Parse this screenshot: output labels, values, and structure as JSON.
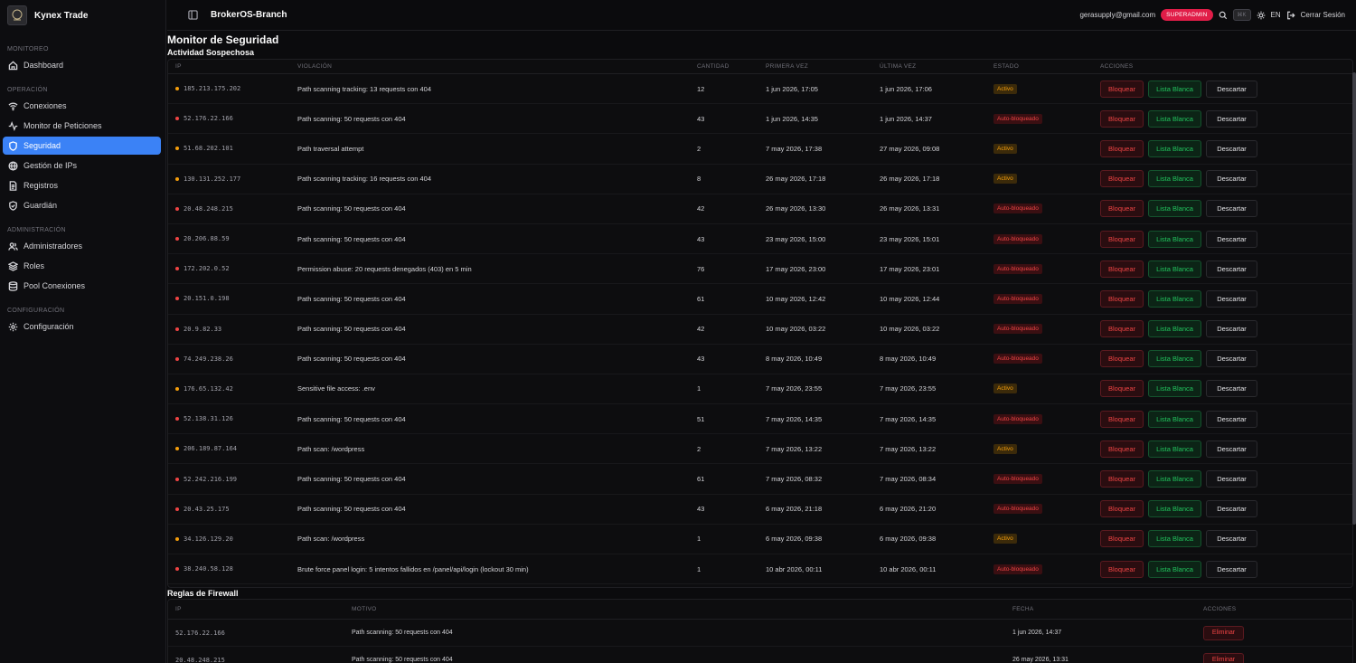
{
  "brand": {
    "name": "Kynex Trade"
  },
  "sidebar": {
    "sections": [
      {
        "label": "MONITOREO",
        "items": [
          {
            "label": "Dashboard",
            "icon": "home-icon"
          }
        ]
      },
      {
        "label": "OPERACIÓN",
        "items": [
          {
            "label": "Conexiones",
            "icon": "wifi-icon"
          },
          {
            "label": "Monitor de Peticiones",
            "icon": "activity-icon"
          },
          {
            "label": "Seguridad",
            "icon": "shield-icon",
            "active": true
          },
          {
            "label": "Gestión de IPs",
            "icon": "globe-icon"
          },
          {
            "label": "Registros",
            "icon": "file-icon"
          },
          {
            "label": "Guardián",
            "icon": "shield-check-icon"
          }
        ]
      },
      {
        "label": "ADMINISTRACIÓN",
        "items": [
          {
            "label": "Administradores",
            "icon": "users-icon"
          },
          {
            "label": "Roles",
            "icon": "layers-icon"
          },
          {
            "label": "Pool Conexiones",
            "icon": "database-icon"
          }
        ]
      },
      {
        "label": "CONFIGURACIÓN",
        "items": [
          {
            "label": "Configuración",
            "icon": "gear-icon"
          }
        ]
      }
    ]
  },
  "topbar": {
    "title": "BrokerOS-Branch",
    "email": "gerasupply@gmail.com",
    "role_badge": "SUPERADMIN",
    "kbd": "⌘K",
    "lang": "EN",
    "logout": "Cerrar Sesión"
  },
  "page": {
    "title": "Monitor de Seguridad",
    "suspicious_title": "Actividad Sospechosa",
    "firewall_title": "Reglas de Firewall"
  },
  "suspicious": {
    "headers": {
      "ip": "IP",
      "violation": "VIOLACIÓN",
      "qty": "CANTIDAD",
      "first": "PRIMERA VEZ",
      "last": "ÚLTIMA VEZ",
      "state": "ESTADO",
      "actions": "ACCIONES"
    },
    "actions": {
      "block": "Bloquear",
      "whitelist": "Lista Blanca",
      "discard": "Descartar"
    },
    "rows": [
      {
        "ip": "185.213.175.202",
        "violation": "Path scanning tracking: 13 requests con 404",
        "qty": "12",
        "first": "1 jun 2026, 17:05",
        "last": "1 jun 2026, 17:06",
        "state": "Activo",
        "kind": "active"
      },
      {
        "ip": "52.176.22.166",
        "violation": "Path scanning: 50 requests con 404",
        "qty": "43",
        "first": "1 jun 2026, 14:35",
        "last": "1 jun 2026, 14:37",
        "state": "Auto-bloqueado",
        "kind": "auto"
      },
      {
        "ip": "51.68.202.101",
        "violation": "Path traversal attempt",
        "qty": "2",
        "first": "7 may 2026, 17:38",
        "last": "27 may 2026, 09:08",
        "state": "Activo",
        "kind": "active"
      },
      {
        "ip": "130.131.252.177",
        "violation": "Path scanning tracking: 16 requests con 404",
        "qty": "8",
        "first": "26 may 2026, 17:18",
        "last": "26 may 2026, 17:18",
        "state": "Activo",
        "kind": "active"
      },
      {
        "ip": "20.48.248.215",
        "violation": "Path scanning: 50 requests con 404",
        "qty": "42",
        "first": "26 may 2026, 13:30",
        "last": "26 may 2026, 13:31",
        "state": "Auto-bloqueado",
        "kind": "auto"
      },
      {
        "ip": "20.206.88.59",
        "violation": "Path scanning: 50 requests con 404",
        "qty": "43",
        "first": "23 may 2026, 15:00",
        "last": "23 may 2026, 15:01",
        "state": "Auto-bloqueado",
        "kind": "auto"
      },
      {
        "ip": "172.202.0.52",
        "violation": "Permission abuse: 20 requests denegados (403) en 5 min",
        "qty": "76",
        "first": "17 may 2026, 23:00",
        "last": "17 may 2026, 23:01",
        "state": "Auto-bloqueado",
        "kind": "auto"
      },
      {
        "ip": "20.151.0.198",
        "violation": "Path scanning: 50 requests con 404",
        "qty": "61",
        "first": "10 may 2026, 12:42",
        "last": "10 may 2026, 12:44",
        "state": "Auto-bloqueado",
        "kind": "auto"
      },
      {
        "ip": "20.9.82.33",
        "violation": "Path scanning: 50 requests con 404",
        "qty": "42",
        "first": "10 may 2026, 03:22",
        "last": "10 may 2026, 03:22",
        "state": "Auto-bloqueado",
        "kind": "auto"
      },
      {
        "ip": "74.249.238.26",
        "violation": "Path scanning: 50 requests con 404",
        "qty": "43",
        "first": "8 may 2026, 10:49",
        "last": "8 may 2026, 10:49",
        "state": "Auto-bloqueado",
        "kind": "auto"
      },
      {
        "ip": "176.65.132.42",
        "violation": "Sensitive file access: .env",
        "qty": "1",
        "first": "7 may 2026, 23:55",
        "last": "7 may 2026, 23:55",
        "state": "Activo",
        "kind": "active"
      },
      {
        "ip": "52.138.31.126",
        "violation": "Path scanning: 50 requests con 404",
        "qty": "51",
        "first": "7 may 2026, 14:35",
        "last": "7 may 2026, 14:35",
        "state": "Auto-bloqueado",
        "kind": "auto"
      },
      {
        "ip": "206.189.87.164",
        "violation": "Path scan: /wordpress",
        "qty": "2",
        "first": "7 may 2026, 13:22",
        "last": "7 may 2026, 13:22",
        "state": "Activo",
        "kind": "active"
      },
      {
        "ip": "52.242.216.199",
        "violation": "Path scanning: 50 requests con 404",
        "qty": "61",
        "first": "7 may 2026, 08:32",
        "last": "7 may 2026, 08:34",
        "state": "Auto-bloqueado",
        "kind": "auto"
      },
      {
        "ip": "20.43.25.175",
        "violation": "Path scanning: 50 requests con 404",
        "qty": "43",
        "first": "6 may 2026, 21:18",
        "last": "6 may 2026, 21:20",
        "state": "Auto-bloqueado",
        "kind": "auto"
      },
      {
        "ip": "34.126.129.20",
        "violation": "Path scan: /wordpress",
        "qty": "1",
        "first": "6 may 2026, 09:38",
        "last": "6 may 2026, 09:38",
        "state": "Activo",
        "kind": "active"
      },
      {
        "ip": "38.240.58.128",
        "violation": "Brute force panel login: 5 intentos fallidos en /panel/api/login (lockout 30 min)",
        "qty": "1",
        "first": "10 abr 2026, 00:11",
        "last": "10 abr 2026, 00:11",
        "state": "Auto-bloqueado",
        "kind": "auto"
      }
    ]
  },
  "firewall": {
    "headers": {
      "ip": "IP",
      "reason": "MOTIVO",
      "date": "FECHA",
      "actions": "ACCIONES"
    },
    "delete_label": "Eliminar",
    "rows": [
      {
        "ip": "52.176.22.166",
        "reason": "Path scanning: 50 requests con 404",
        "date": "1 jun 2026, 14:37"
      },
      {
        "ip": "20.48.248.215",
        "reason": "Path scanning: 50 requests con 404",
        "date": "26 may 2026, 13:31"
      }
    ]
  },
  "colors": {
    "accent": "#3b82f6",
    "danger": "#ef4444",
    "success": "#22c55e",
    "warning": "#f59e0b",
    "badge": "#e11d48"
  }
}
